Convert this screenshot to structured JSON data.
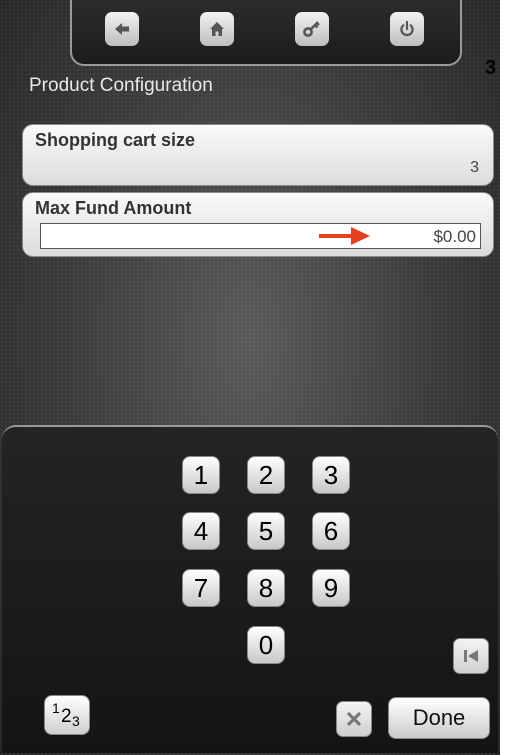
{
  "nav": {
    "buttons": [
      "back-arrow-icon",
      "home-icon",
      "key-icon",
      "power-icon"
    ]
  },
  "page_number": "3",
  "header": {
    "title": "Product Configuration"
  },
  "settings": {
    "cart_size": {
      "label": "Shopping cart size",
      "value": "3"
    },
    "max_fund": {
      "label": "Max Fund Amount",
      "value": "$0.00"
    }
  },
  "keypad": {
    "digits": [
      "1",
      "2",
      "3",
      "4",
      "5",
      "6",
      "7",
      "8",
      "9",
      "0"
    ],
    "mode_key": {
      "base": "1",
      "sub1": "2",
      "sub2": "3"
    },
    "done_label": "Done",
    "icons": {
      "clear": "x-icon",
      "skip": "skip-to-start-icon"
    }
  },
  "colors": {
    "arrow": "#e8401f",
    "background": "#3a3a3a"
  }
}
